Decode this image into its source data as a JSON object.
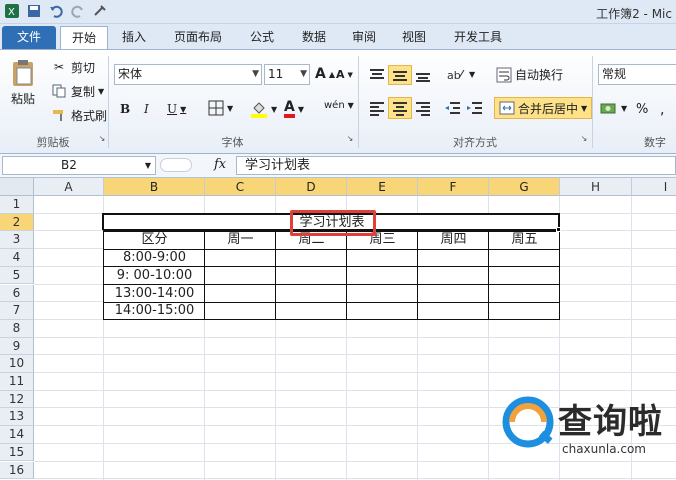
{
  "app": {
    "window_title": "工作簿2 - Mic"
  },
  "tabs": [
    "文件",
    "开始",
    "插入",
    "页面布局",
    "公式",
    "数据",
    "审阅",
    "视图",
    "开发工具"
  ],
  "clipboard": {
    "paste": "粘贴",
    "cut": "剪切",
    "copy": "复制",
    "format_painter": "格式刷",
    "group": "剪贴板"
  },
  "font": {
    "name": "宋体",
    "size": "11",
    "group": "字体",
    "bold": "B",
    "italic": "I",
    "underline": "U",
    "grow": "A",
    "shrink": "A",
    "font_color": "A",
    "wen": "wén"
  },
  "alignment": {
    "wrap": "自动换行",
    "merge": "合并后居中",
    "group": "对齐方式"
  },
  "number": {
    "format": "常规",
    "percent": "%",
    "group": "数字"
  },
  "formula_bar": {
    "name_box": "B2",
    "fx": "fx",
    "content": "学习计划表"
  },
  "sheet": {
    "columns": [
      "A",
      "B",
      "C",
      "D",
      "E",
      "F",
      "G",
      "H",
      "I"
    ],
    "rows": [
      "1",
      "2",
      "3",
      "4",
      "5",
      "6",
      "7",
      "8",
      "9",
      "10",
      "11",
      "12",
      "13",
      "14",
      "15",
      "16"
    ],
    "title": "学习计划表",
    "header": [
      "区分",
      "周一",
      "周二",
      "周三",
      "周四",
      "周五"
    ],
    "times": [
      "8:00-9:00",
      "9: 00-10:00",
      "13:00-14:00",
      "14:00-15:00"
    ]
  },
  "watermark": {
    "brand": "查询啦",
    "domain": "chaxunla.com"
  },
  "colors": {
    "accent": "#2f6fb6",
    "selected_header": "#f8d678",
    "highlight_box": "#e0403a"
  }
}
